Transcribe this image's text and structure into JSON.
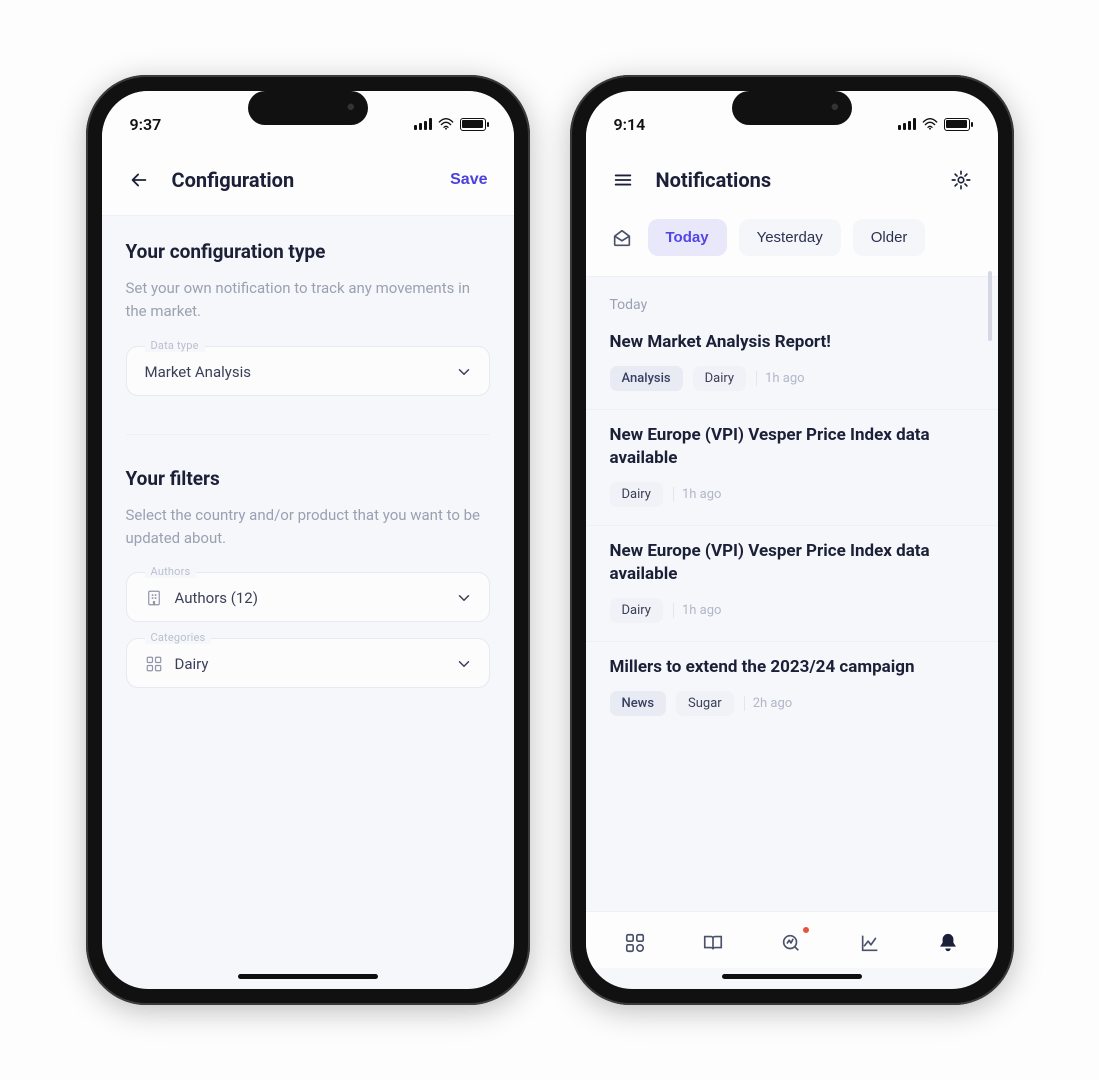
{
  "left": {
    "status": {
      "time": "9:37"
    },
    "header": {
      "title": "Configuration",
      "save_label": "Save"
    },
    "config_type": {
      "title": "Your configuration type",
      "desc": "Set your own notification to track any movements in the market.",
      "field": {
        "label": "Data type",
        "value": "Market Analysis"
      }
    },
    "filters": {
      "title": "Your filters",
      "desc": "Select the country and/or product that you want to be updated about.",
      "authors": {
        "label": "Authors",
        "value": "Authors (12)"
      },
      "categories": {
        "label": "Categories",
        "value": "Dairy"
      }
    }
  },
  "right": {
    "status": {
      "time": "9:14"
    },
    "header": {
      "title": "Notifications"
    },
    "chips": {
      "today": "Today",
      "yesterday": "Yesterday",
      "older": "Older"
    },
    "group_label": "Today",
    "items": [
      {
        "title": "New Market Analysis Report!",
        "tag1": "Analysis",
        "tag2": "Dairy",
        "time": "1h ago"
      },
      {
        "title": "New Europe (VPI) Vesper Price Index data available",
        "tag1": "Dairy",
        "time": "1h ago"
      },
      {
        "title": "New Europe (VPI) Vesper Price Index data available",
        "tag1": "Dairy",
        "time": "1h ago"
      },
      {
        "title": "Millers to extend the 2023/24 campaign",
        "tag1": "News",
        "tag2": "Sugar",
        "time": "2h ago"
      }
    ]
  }
}
